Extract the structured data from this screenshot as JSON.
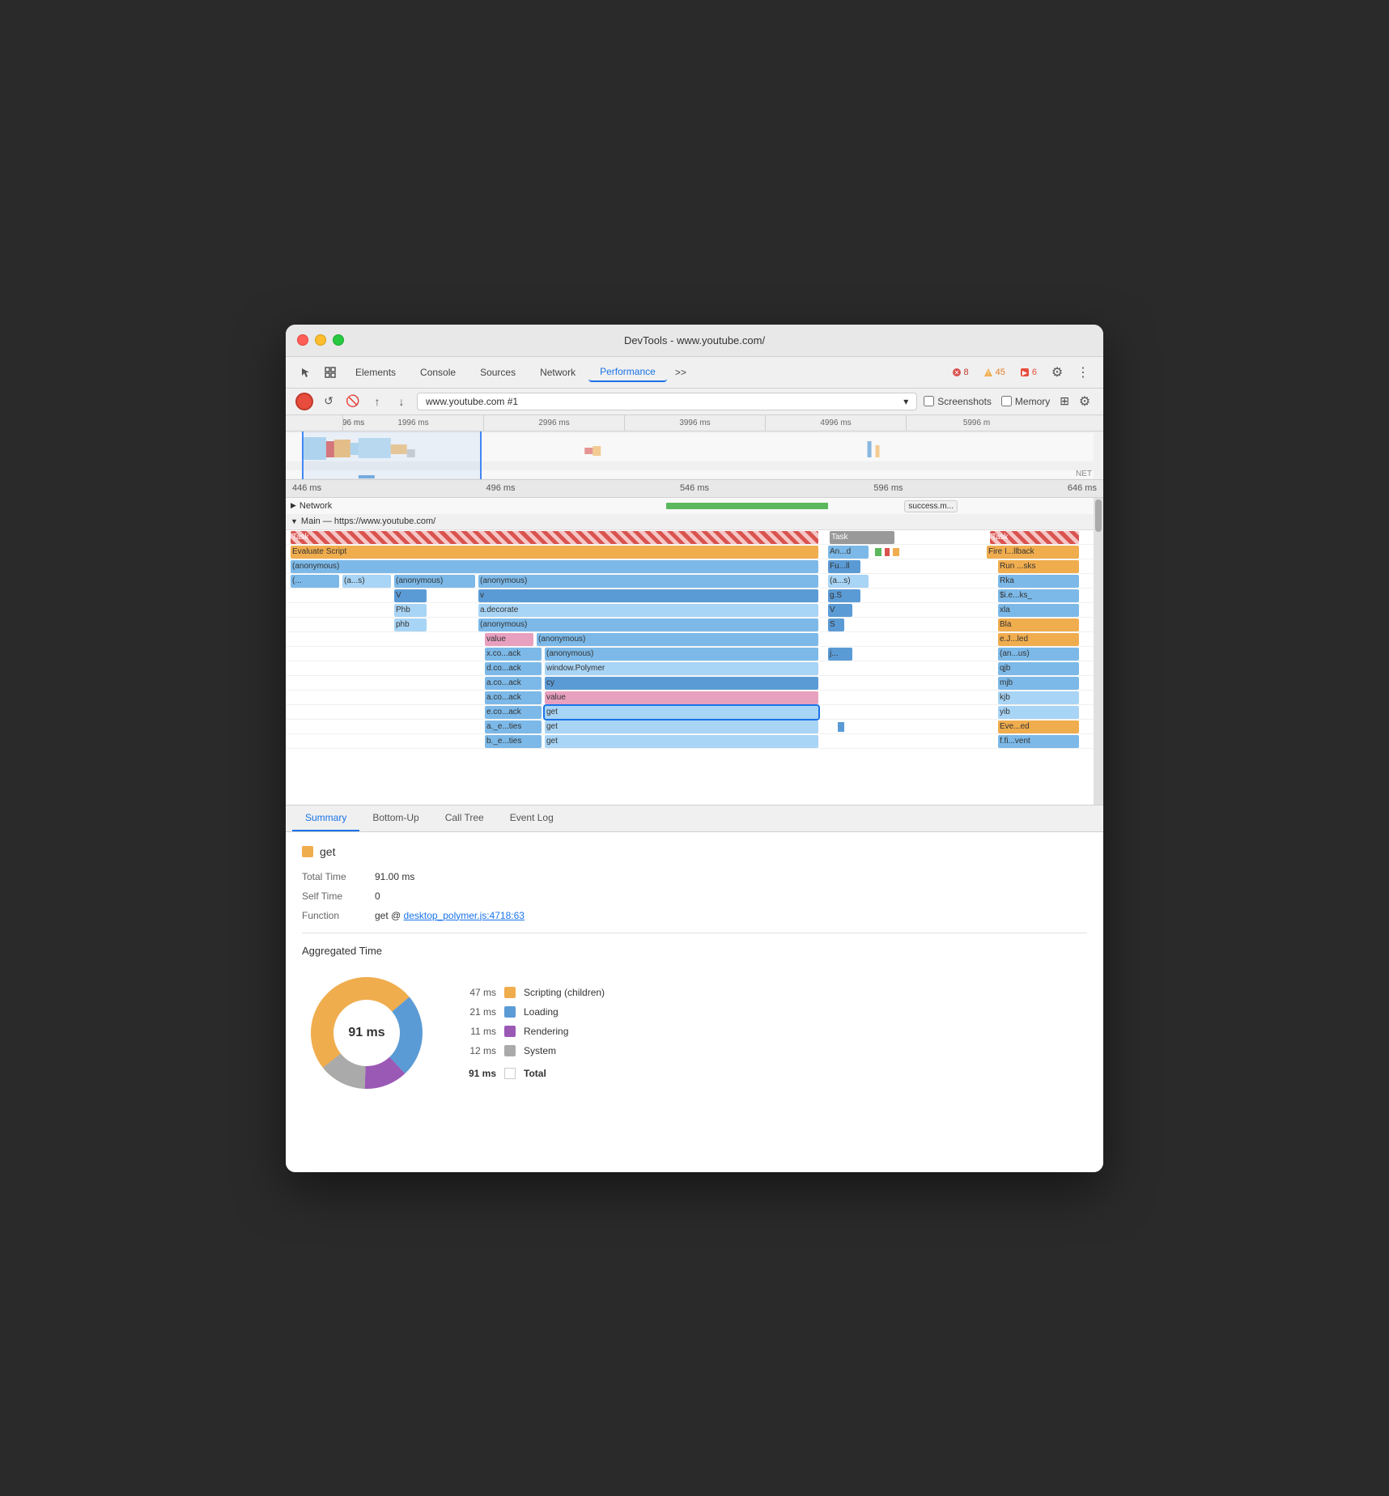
{
  "window": {
    "title": "DevTools - www.youtube.com/"
  },
  "traffic_lights": {
    "red": "close",
    "yellow": "minimize",
    "green": "maximize"
  },
  "nav": {
    "tabs": [
      "Elements",
      "Console",
      "Sources",
      "Network",
      "Performance",
      ">>"
    ],
    "active_tab": "Performance"
  },
  "badges": {
    "errors": "8",
    "warnings": "45",
    "logs": "6"
  },
  "secondary_toolbar": {
    "url": "www.youtube.com #1",
    "screenshots_label": "Screenshots",
    "memory_label": "Memory"
  },
  "timeline": {
    "marks": [
      "1996 ms",
      "2996 ms",
      "3996 ms",
      "4996 ms",
      "5996 m"
    ],
    "detail_marks": [
      "446 ms",
      "496 ms",
      "546 ms",
      "596 ms",
      "646 ms"
    ]
  },
  "flame": {
    "network_label": "Network",
    "main_label": "Main — https://www.youtube.com/",
    "success_label": "success.m...",
    "rows": [
      {
        "label": "Task",
        "type": "task-striped",
        "right_labels": [
          "Task",
          "Task"
        ]
      },
      {
        "label": "Evaluate Script",
        "type": "evaluate",
        "right_labels": [
          "An...d",
          "Fire I...llback"
        ]
      },
      {
        "label": "(anonymous)",
        "type": "anon",
        "right_labels": [
          "Fu...ll",
          "Run ...sks"
        ]
      },
      {
        "left_items": [
          "(...",
          "(a...s)",
          "(anonymous)",
          "(anonymous)"
        ],
        "right_labels": [
          "(a...s)",
          "Rka"
        ]
      },
      {
        "left_items": [
          "V",
          "v"
        ],
        "right_labels": [
          "g.S",
          "$i.e...ks_"
        ]
      },
      {
        "left_items": [
          "Phb",
          "a.decorate"
        ],
        "right_labels": [
          "V",
          "xla"
        ]
      },
      {
        "left_items": [
          "phb",
          "(anonymous)"
        ],
        "right_labels": [
          "S",
          "Bla"
        ]
      },
      {
        "left_items": [
          "value",
          "(anonymous)"
        ],
        "right_labels": [
          "",
          "e.J...led"
        ]
      },
      {
        "left_items": [
          "x.co...ack",
          "(anonymous)"
        ],
        "right_labels": [
          "j...",
          "(an...us)"
        ]
      },
      {
        "left_items": [
          "d.co...ack",
          "window.Polymer"
        ],
        "right_labels": [
          "",
          "qjb"
        ]
      },
      {
        "left_items": [
          "a.co...ack",
          "cy"
        ],
        "right_labels": [
          "",
          "mjb"
        ]
      },
      {
        "left_items": [
          "a.co...ack",
          "value"
        ],
        "right_labels": [
          "",
          "kjb"
        ]
      },
      {
        "left_items": [
          "e.co...ack",
          "get"
        ],
        "right_labels": [
          "",
          "yib"
        ],
        "selected": true
      },
      {
        "left_items": [
          "a._e...ties",
          "get"
        ],
        "right_labels": [
          "",
          "Eve...ed"
        ]
      },
      {
        "left_items": [
          "b._e...ties",
          "get"
        ],
        "right_labels": [
          "",
          "f.fi...vent"
        ]
      }
    ]
  },
  "bottom_tabs": [
    "Summary",
    "Bottom-Up",
    "Call Tree",
    "Event Log"
  ],
  "active_bottom_tab": "Summary",
  "summary": {
    "title": "get",
    "title_icon_color": "#f0ad4e",
    "total_time_label": "Total Time",
    "total_time_value": "91.00 ms",
    "self_time_label": "Self Time",
    "self_time_value": "0",
    "function_label": "Function",
    "function_text": "get @ ",
    "function_link": "desktop_polymer.js:4718:63",
    "aggregated_title": "Aggregated Time",
    "donut_center": "91 ms",
    "legend": [
      {
        "ms": "47 ms",
        "color": "#f0ad4e",
        "name": "Scripting (children)"
      },
      {
        "ms": "21 ms",
        "color": "#5b9bd5",
        "name": "Loading"
      },
      {
        "ms": "11 ms",
        "color": "#9b59b6",
        "name": "Rendering"
      },
      {
        "ms": "12 ms",
        "color": "#aaa",
        "name": "System"
      }
    ],
    "total_row": {
      "ms": "91 ms",
      "name": "Total"
    }
  }
}
